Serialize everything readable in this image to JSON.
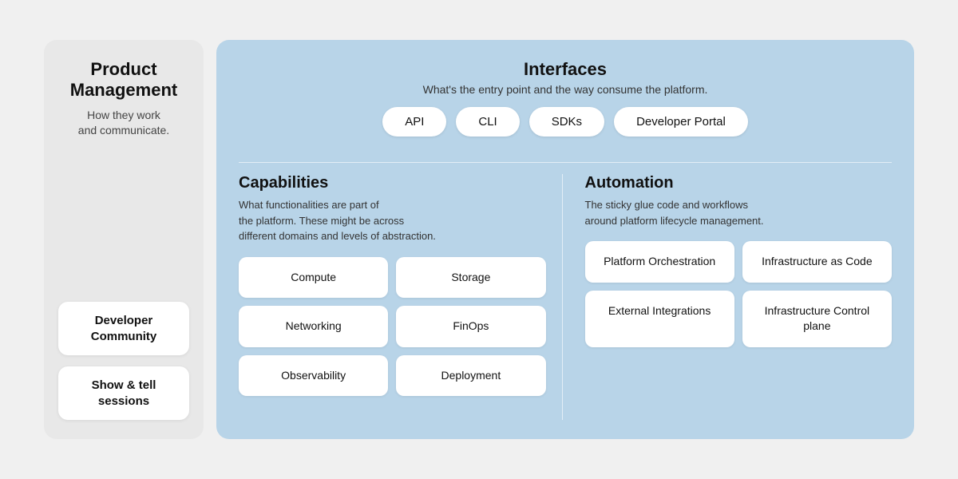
{
  "sidebar": {
    "title": "Product\nManagement",
    "subtitle": "How they work\nand communicate.",
    "cards": [
      {
        "label": "Developer\nCommunity"
      },
      {
        "label": "Show & tell\nsessions"
      }
    ]
  },
  "interfaces": {
    "title": "Interfaces",
    "desc": "What's the entry point and the way consume the platform.",
    "pills": [
      "API",
      "CLI",
      "SDKs",
      "Developer Portal"
    ]
  },
  "capabilities": {
    "title": "Capabilities",
    "desc": "What functionalities are part of\nthe platform. These might be across\ndifferent domains and levels of abstraction.",
    "cards": [
      "Compute",
      "Storage",
      "Networking",
      "FinOps",
      "Observability",
      "Deployment"
    ]
  },
  "automation": {
    "title": "Automation",
    "desc": "The sticky glue code and workflows\naround platform lifecycle management.",
    "cards": [
      "Platform\nOrchestration",
      "Infrastructure\nas Code",
      "External\nIntegrations",
      "Infrastructure\nControl plane"
    ]
  }
}
